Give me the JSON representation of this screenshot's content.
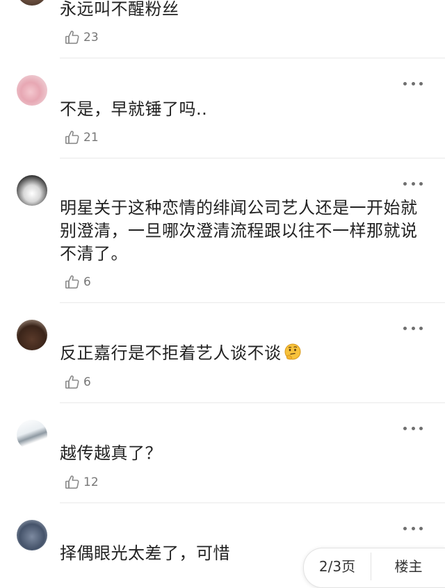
{
  "comments": [
    {
      "text": "永远叫不醒粉丝",
      "likes": "23"
    },
    {
      "text": "不是，早就锤了吗..",
      "likes": "21"
    },
    {
      "text": "明星关于这种恋情的绯闻公司艺人还是一开始就别澄清，一旦哪次澄清流程跟以往不一样那就说不清了。",
      "likes": "6"
    },
    {
      "text": "反正嘉行是不拒着艺人谈不谈",
      "likes": "6",
      "emoji": "thinking-face-emoji"
    },
    {
      "text": "越传越真了？",
      "likes": "12"
    },
    {
      "text": "择偶眼光太差了，可惜",
      "likes": ""
    }
  ],
  "icons": {
    "like": "thumbs-up-outline-icon",
    "more": "more-dots-icon"
  },
  "pager": {
    "page": "2/3页",
    "floor": "楼主"
  },
  "colors": {
    "text": "#222222",
    "meta": "#777777",
    "divider": "#e9e9e9"
  }
}
